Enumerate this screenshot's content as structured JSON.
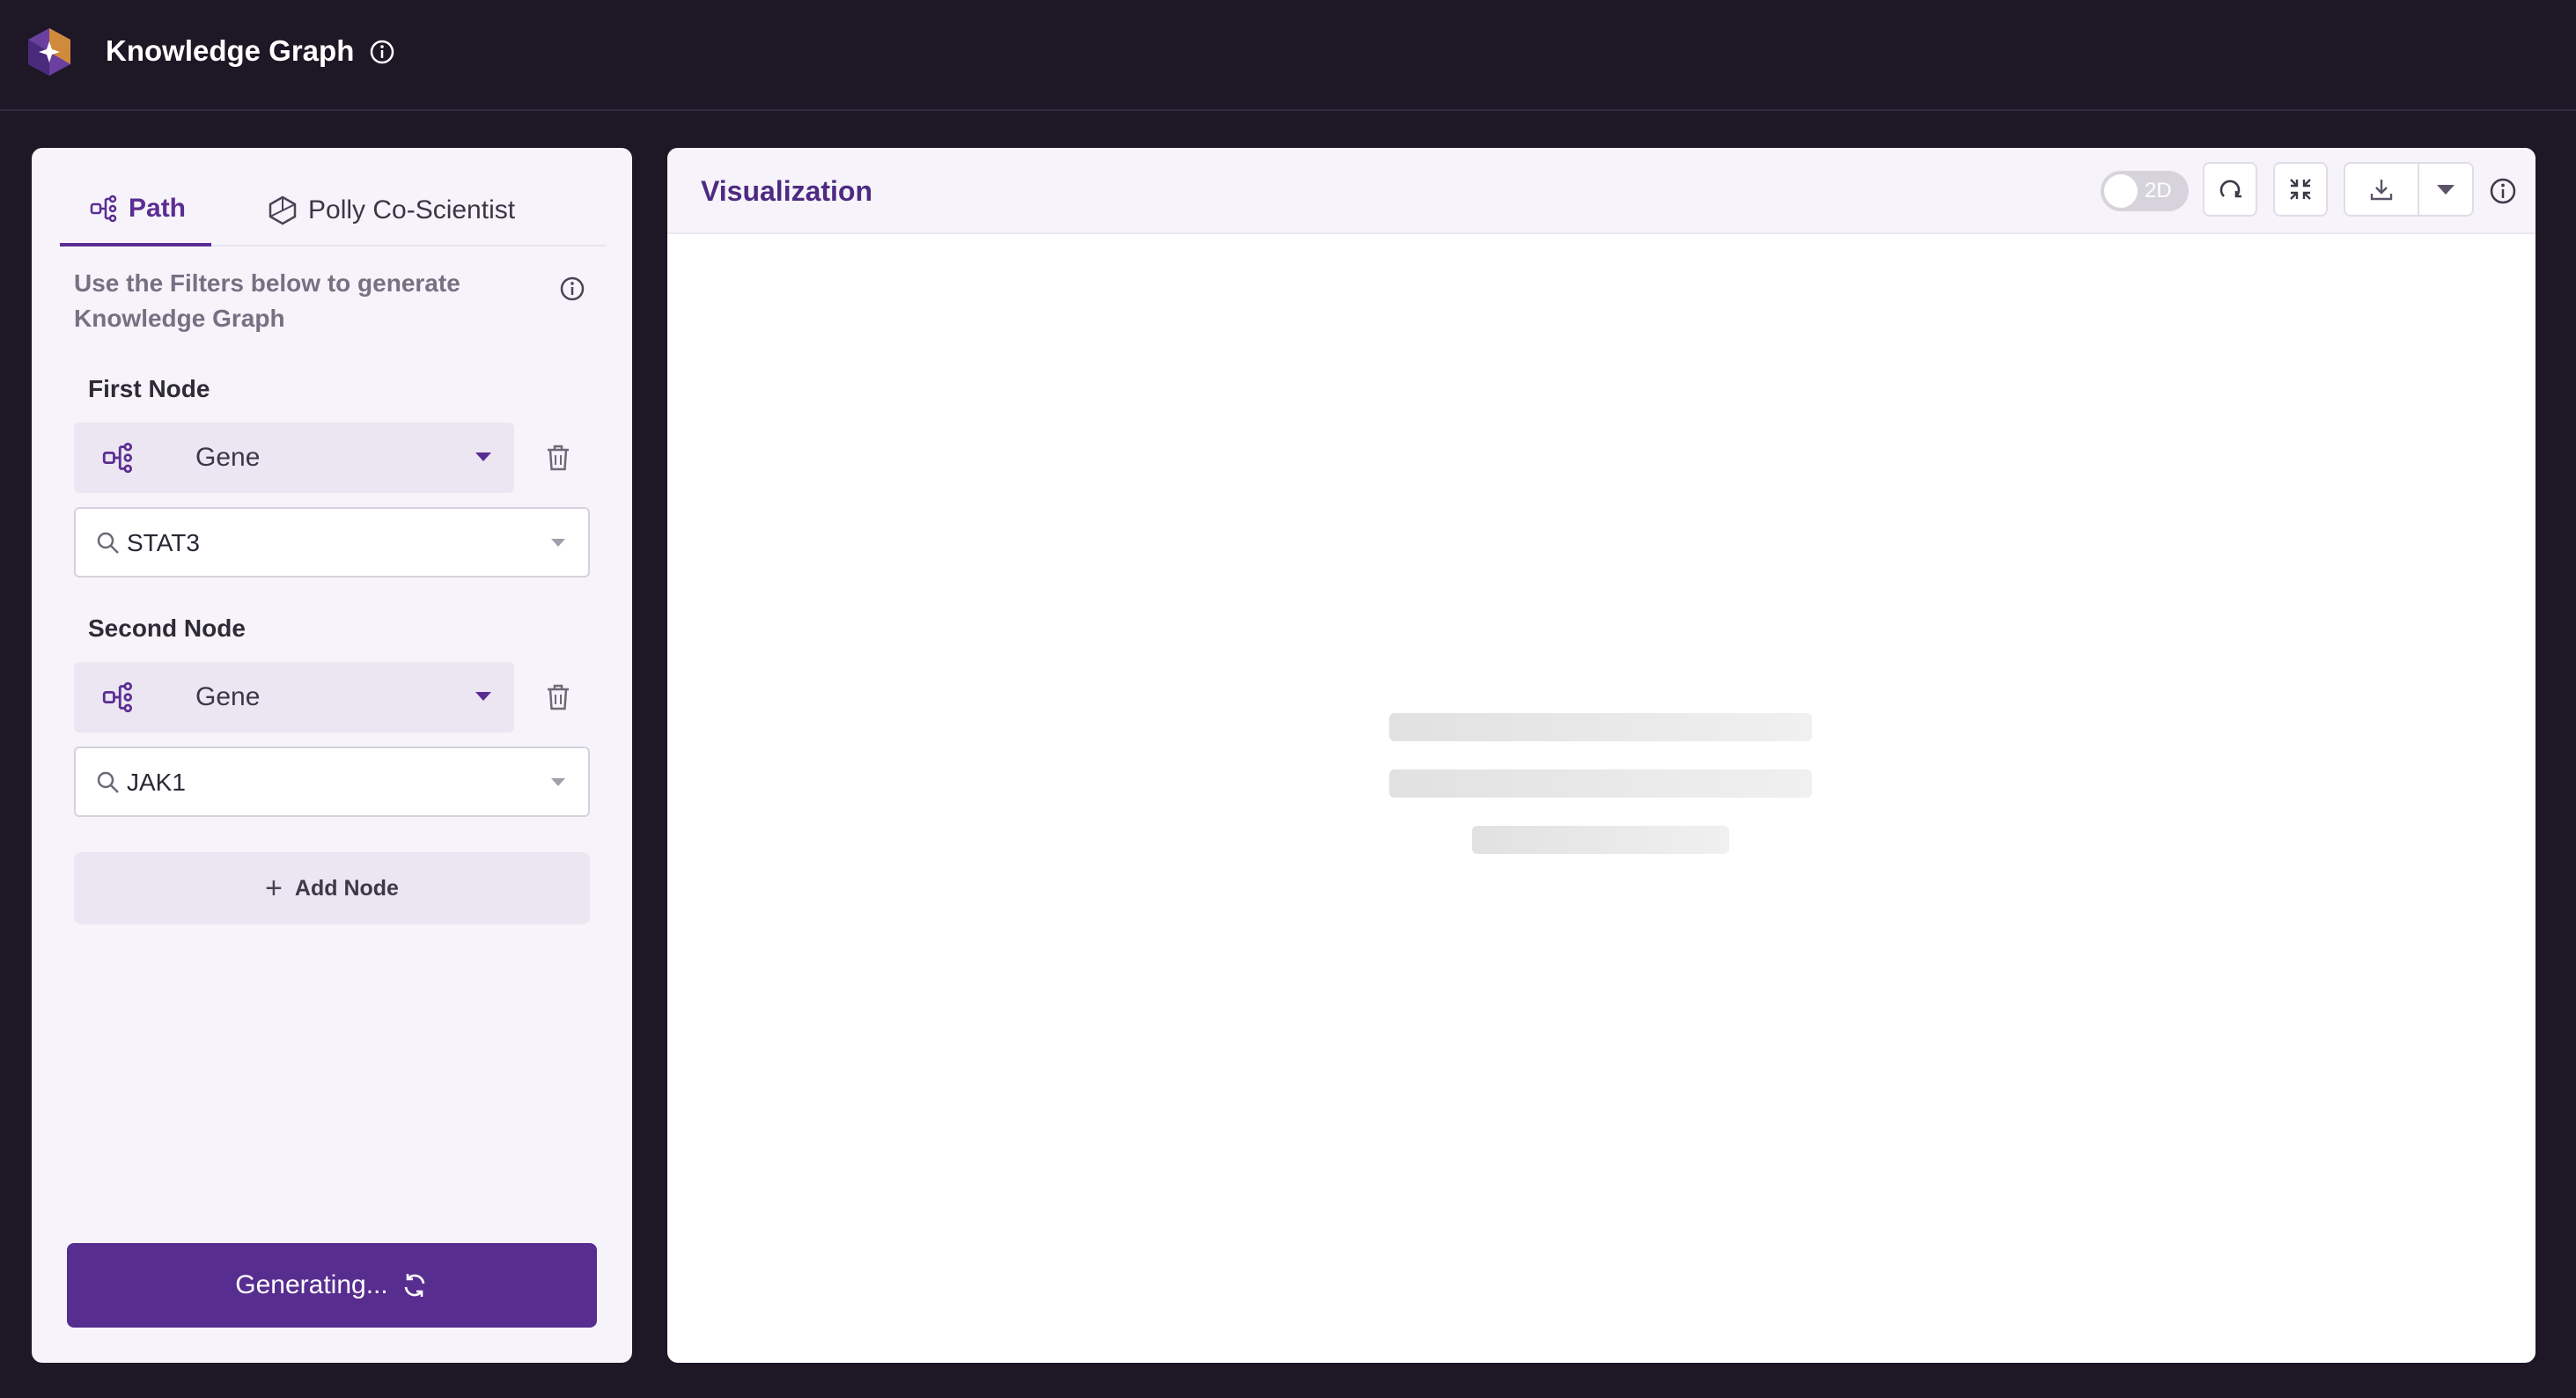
{
  "app": {
    "title": "Knowledge Graph",
    "icons": {
      "logo": "hexagon-sparkle-logo",
      "title_info": "info-icon"
    }
  },
  "left_panel": {
    "tabs": [
      {
        "label": "Path",
        "icon": "node-graph-icon",
        "active": true
      },
      {
        "label": "Polly Co-Scientist",
        "icon": "hexagon-icon",
        "active": false
      }
    ],
    "intro_text": "Use the Filters below to generate Knowledge Graph",
    "first_node": {
      "label": "First Node",
      "type": "Gene",
      "search_value": "STAT3"
    },
    "second_node": {
      "label": "Second Node",
      "type": "Gene",
      "search_value": "JAK1"
    },
    "add_node_label": "Add Node",
    "generate_label": "Generating..."
  },
  "visualization": {
    "title": "Visualization",
    "toggle_label": "2D",
    "toggle_on": false,
    "state": "loading"
  },
  "colors": {
    "background": "#1d1726",
    "accent": "#572d8f",
    "panel": "#f6f4fa",
    "viz_title": "#4e2a82"
  }
}
